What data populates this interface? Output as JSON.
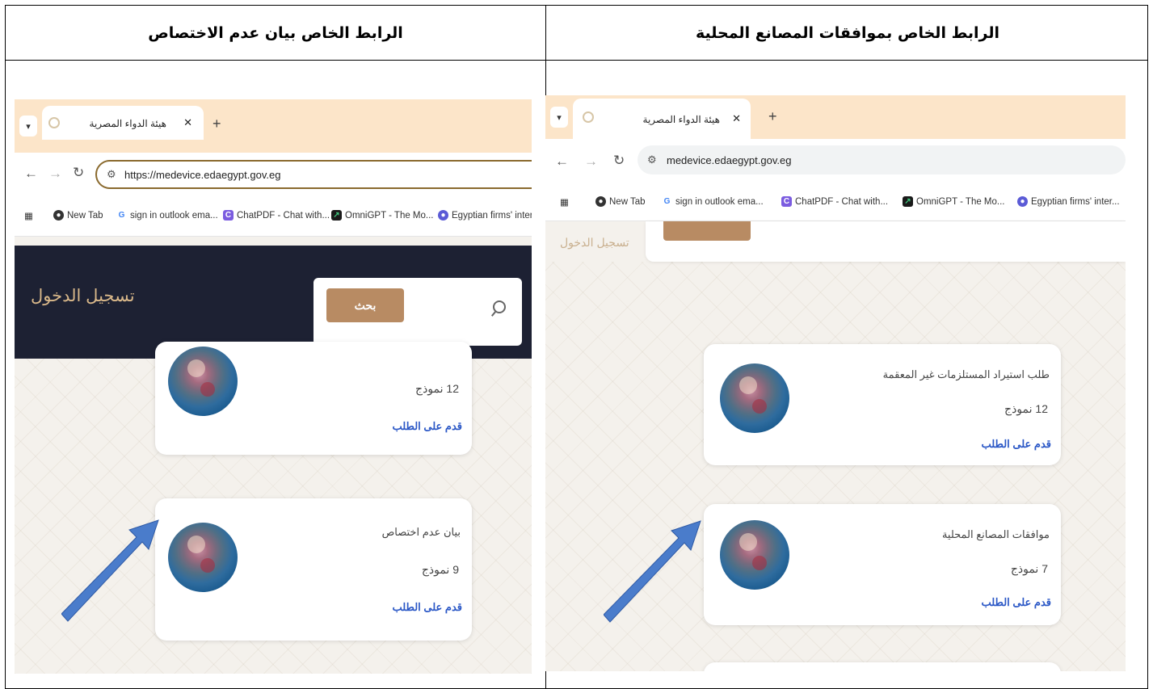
{
  "table": {
    "header_left": "الرابط الخاص بيان عدم الاختصاص",
    "header_right": "الرابط الخاص بموافقات المصانع المحلية"
  },
  "left_panel": {
    "tab_title": "هيئة الدواء المصرية",
    "url": "https://medevice.edaegypt.gov.eg",
    "bookmarks": [
      "New Tab",
      "sign in outlook ema...",
      "ChatPDF - Chat with...",
      "OmniGPT - The Mo...",
      "Egyptian firms' inter..."
    ],
    "login_label": "تسجيل الدخول",
    "search_button": "بحث",
    "cards": [
      {
        "count": "12 نموذج",
        "link": "قدم على الطلب"
      },
      {
        "title": "بيان عدم اختصاص",
        "count": "9 نموذج",
        "link": "قدم على الطلب"
      }
    ]
  },
  "right_panel": {
    "tab_title": "هيئة الدواء المصرية",
    "url": "medevice.edaegypt.gov.eg",
    "bookmarks": [
      "New Tab",
      "sign in outlook ema...",
      "ChatPDF - Chat with...",
      "OmniGPT - The Mo...",
      "Egyptian firms' inter..."
    ],
    "login_label": "تسجيل الدخول",
    "cards": [
      {
        "title": "طلب استيراد المستلزمات غير المعقمة",
        "count": "12 نموذج",
        "link": "قدم على الطلب"
      },
      {
        "title": "موافقات المصانع المحلية",
        "count": "7 نموذج",
        "link": "قدم على الطلب"
      }
    ]
  },
  "colors": {
    "tab_strip": "#fce5c9",
    "header_bar": "#1d2133",
    "login_text": "#d9b88a",
    "search_button": "#b88b63",
    "link": "#2a57c6",
    "arrow": "#4a7ccb"
  }
}
